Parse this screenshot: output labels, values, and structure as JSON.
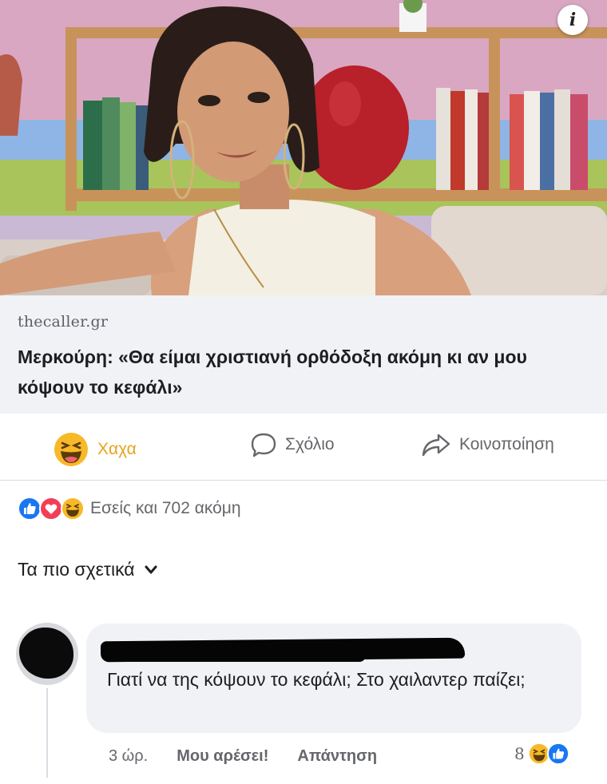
{
  "hero": {
    "info_glyph": "i"
  },
  "link_preview": {
    "domain": "thecaller.gr",
    "title": "Μερκούρη: «Θα είμαι χριστιανή ορθόδοξη ακόμη κι αν μου κόψουν το κεφάλι»"
  },
  "actions": {
    "haha_label": "Χαχα",
    "comment_label": "Σχόλιο",
    "share_label": "Κοινοποίηση",
    "haha_color": "#e7a31e",
    "neutral_color": "#65676b"
  },
  "reactions": {
    "icons": [
      "like-icon",
      "love-icon",
      "haha-icon"
    ],
    "summary": "Εσείς και 702 ακόμη"
  },
  "filter": {
    "label": "Τα πιο σχετικά"
  },
  "comment": {
    "author": "",
    "text": "Γιατί να της κόψουν το κεφάλι; Στο χαιλαντερ παίζει;",
    "time": "3 ώρ.",
    "like_label": "Μου αρέσει!",
    "reply_label": "Απάντηση",
    "reaction_count": "8",
    "reaction_icons": [
      "haha-icon",
      "like-icon"
    ]
  },
  "colors": {
    "like_blue": "#1877f2",
    "love_red": "#f33e58",
    "haha_yellow": "#f7b928"
  }
}
